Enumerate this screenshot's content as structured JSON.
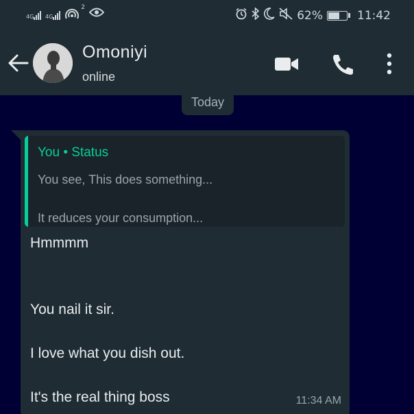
{
  "status_bar": {
    "signal1_label": "4G",
    "signal2_label": "4G",
    "hotspot_count": "2",
    "battery_percent": "62%",
    "battery_level": 0.62,
    "time": "11:42"
  },
  "header": {
    "contact_name": "Omoniyi",
    "contact_status": "online"
  },
  "chat": {
    "date_label": "Today",
    "message": {
      "quote_author": "You • Status",
      "quote_line1": "You see, This does something...",
      "quote_line2": "It reduces your consumption...",
      "lines": [
        "Hmmmm",
        "You nail it sir.",
        "I love what you dish out.",
        "It's the real thing boss"
      ],
      "time": "11:34 AM"
    }
  },
  "colors": {
    "header_bg": "#1f2c34",
    "chat_bg": "#000035",
    "accent_green": "#06cf9c",
    "text_primary": "#e9edef"
  }
}
